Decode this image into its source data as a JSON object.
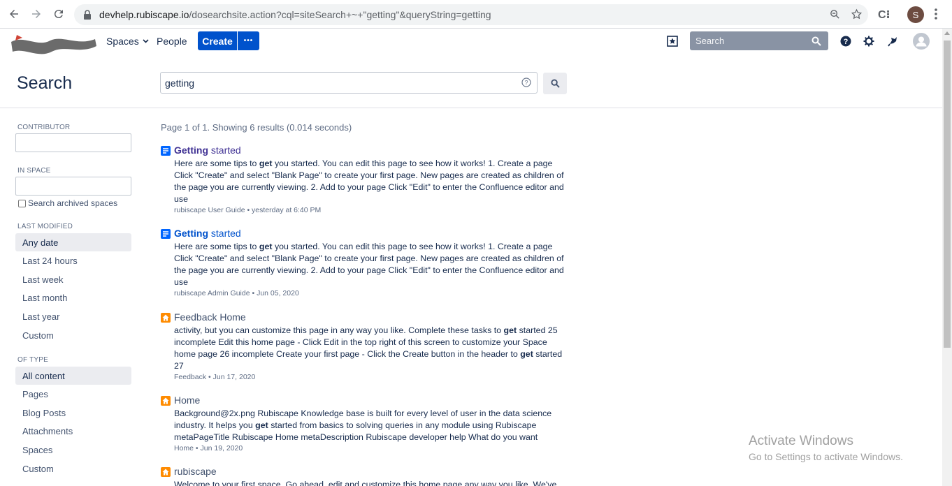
{
  "browser": {
    "url_host": "devhelp.rubiscape.io",
    "url_path": "/dosearchsite.action?cql=siteSearch+~+\"getting\"&queryString=getting",
    "profile_initial": "S",
    "extension_label": "C⁝"
  },
  "header": {
    "spaces_label": "Spaces",
    "people_label": "People",
    "create_label": "Create",
    "more_label": "•••",
    "search_placeholder": "Search"
  },
  "page": {
    "title": "Search",
    "query": "getting"
  },
  "sidebar": {
    "contributor_label": "CONTRIBUTOR",
    "in_space_label": "IN SPACE",
    "archived_label": "Search archived spaces",
    "last_modified_label": "LAST MODIFIED",
    "last_modified_items": [
      {
        "label": "Any date",
        "selected": true
      },
      {
        "label": "Last 24 hours",
        "selected": false
      },
      {
        "label": "Last week",
        "selected": false
      },
      {
        "label": "Last month",
        "selected": false
      },
      {
        "label": "Last year",
        "selected": false
      },
      {
        "label": "Custom",
        "selected": false
      }
    ],
    "of_type_label": "OF TYPE",
    "of_type_items": [
      {
        "label": "All content",
        "selected": true
      },
      {
        "label": "Pages",
        "selected": false
      },
      {
        "label": "Blog Posts",
        "selected": false
      },
      {
        "label": "Attachments",
        "selected": false
      },
      {
        "label": "Spaces",
        "selected": false
      },
      {
        "label": "Custom",
        "selected": false
      }
    ]
  },
  "results": {
    "summary": "Page 1 of 1. Showing 6 results (0.014 seconds)",
    "items": [
      {
        "type": "page",
        "title_bold": "Getting",
        "title_rest": " started",
        "body_html": "Here are some tips to <b>get</b> you started. You can edit this page to see how it works! 1. Create a page Click \"Create\" and select \"Blank Page\" to create your first page. New pages are created as children of the page you are currently viewing. 2. Add to your page Click \"Edit\" to enter the Confluence editor and use",
        "meta": "rubiscape User Guide • yesterday at 6:40 PM"
      },
      {
        "type": "page",
        "title_bold": "Getting",
        "title_rest": " started",
        "body_html": "Here are some tips to <b>get</b> you started. You can edit this page to see how it works! 1. Create a page Click \"Create\" and select \"Blank Page\" to create your first page. New pages are created as children of the page you are currently viewing. 2. Add to your page Click \"Edit\" to enter the Confluence editor and use",
        "meta": "rubiscape Admin Guide • Jun 05, 2020"
      },
      {
        "type": "home",
        "title_bold": "",
        "title_rest": "Feedback Home",
        "body_html": "activity, but you can customize this page in any way you like. Complete these tasks to <b>get</b> started 25 incomplete Edit this home page - Click Edit in the top right of this screen to customize your Space home page 26 incomplete Create your first page - Click the Create button in the header to <b>get</b> started 27",
        "meta": "Feedback • Jun 17, 2020"
      },
      {
        "type": "home",
        "title_bold": "",
        "title_rest": "Home",
        "body_html": "Background@2x.png Rubiscape Knowledge base is built for every level of user in the data science industry. It helps you <b>get</b> started from basics to solving queries in any module using Rubiscape metaPageTitle Rubiscape Home metaDescription Rubiscape developer help What do you want",
        "meta": "Home • Jun 19, 2020"
      },
      {
        "type": "home",
        "title_bold": "",
        "title_rest": "rubiscape",
        "body_html": "Welcome to your first space. Go ahead, edit and customize this home page any way you like. We've",
        "meta": ""
      }
    ]
  },
  "watermark": {
    "line1": "Activate Windows",
    "line2": "Go to Settings to activate Windows."
  },
  "colors": {
    "brand_blue": "#0052cc",
    "home_icon": "#ff8b00",
    "page_icon": "#0065ff"
  }
}
